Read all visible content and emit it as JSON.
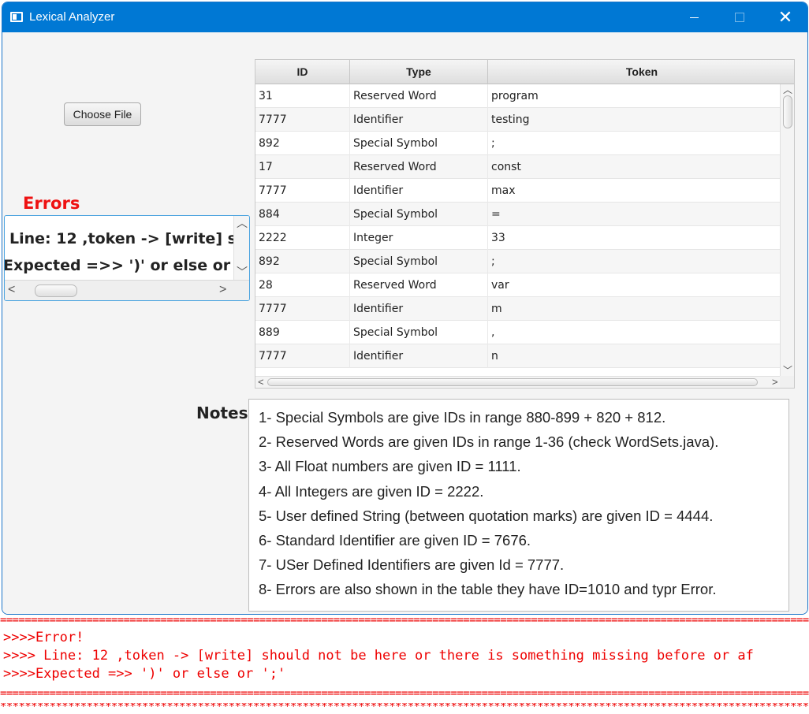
{
  "window": {
    "title": "Lexical Analyzer",
    "close_glyph": "✕"
  },
  "controls": {
    "choose_file": "Choose File"
  },
  "errors": {
    "label": "Errors",
    "lines": [
      "Line: 12 ,token -> [write] s",
      "Expected =>> ')' or else or"
    ]
  },
  "table": {
    "columns": [
      "ID",
      "Type",
      "Token"
    ],
    "rows": [
      [
        "31",
        "Reserved Word",
        "program"
      ],
      [
        "7777",
        "Identifier",
        "testing"
      ],
      [
        "892",
        "Special Symbol",
        ";"
      ],
      [
        "17",
        "Reserved Word",
        "const"
      ],
      [
        "7777",
        "Identifier",
        "max"
      ],
      [
        "884",
        "Special Symbol",
        "="
      ],
      [
        "2222",
        "Integer",
        "33"
      ],
      [
        "892",
        "Special Symbol",
        ";"
      ],
      [
        "28",
        "Reserved Word",
        "var"
      ],
      [
        "7777",
        "Identifier",
        "m"
      ],
      [
        "889",
        "Special Symbol",
        ","
      ],
      [
        "7777",
        "Identifier",
        "n"
      ]
    ]
  },
  "notes": {
    "label": "Notes",
    "lines": [
      "1-  Special Symbols are give IDs in range 880-899 + 820 + 812.",
      "2- Reserved Words are given IDs in range 1-36 (check WordSets.java).",
      "3- All Float numbers are given ID = 1111.",
      "4- All Integers are given ID = 2222.",
      "5- User defined String (between quotation marks) are given ID = 4444.",
      "6- Standard Identifier are given ID = 7676.",
      "7- USer Defined Identifiers are given Id = 7777.",
      "8- Errors are also shown in the table they have ID=1010 and typr Error."
    ]
  },
  "console": {
    "rule_top": "=================================================================================================================================================",
    "line1": ">>>>Error!",
    "line2": ">>>> Line: 12 ,token -> [write] should not be here or there is something missing before or af",
    "line3": ">>>>Expected =>> ')' or else or ';'",
    "rule_mid": "=================================================================================================================================================",
    "rule_bottom": "*************************************************************************************************************************************************"
  }
}
